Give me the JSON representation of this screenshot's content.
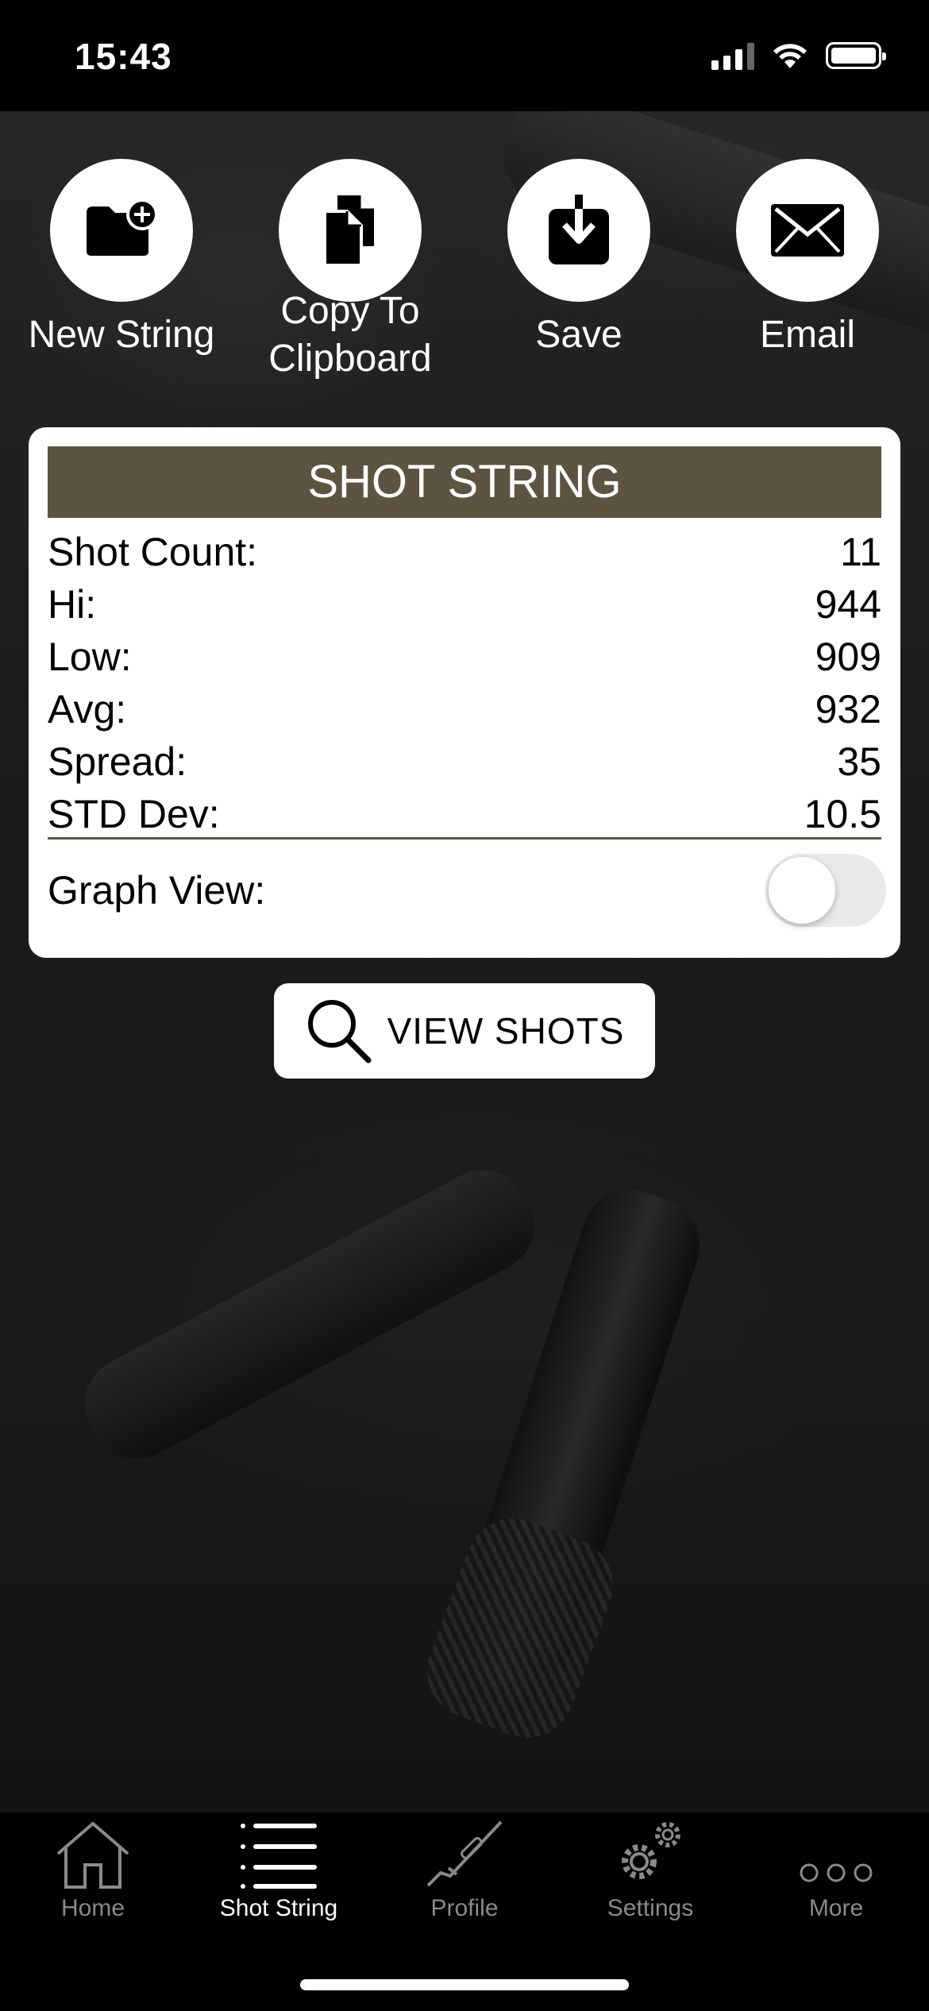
{
  "status_bar": {
    "time": "15:43"
  },
  "actions": [
    {
      "label": "New String",
      "icon": "folder-plus-icon"
    },
    {
      "label": "Copy To Clipboard",
      "icon": "copy-icon"
    },
    {
      "label": "Save",
      "icon": "download-icon"
    },
    {
      "label": "Email",
      "icon": "envelope-icon"
    }
  ],
  "card": {
    "title": "SHOT STRING",
    "stats": [
      {
        "label": "Shot Count:",
        "value": "11"
      },
      {
        "label": "Hi:",
        "value": "944"
      },
      {
        "label": "Low:",
        "value": "909"
      },
      {
        "label": "Avg:",
        "value": "932"
      },
      {
        "label": "Spread:",
        "value": "35"
      },
      {
        "label": "STD Dev:",
        "value": "10.5"
      }
    ],
    "graph_view_label": "Graph View:",
    "graph_view_enabled": false
  },
  "view_shots_label": "VIEW SHOTS",
  "tabs": [
    {
      "label": "Home",
      "icon": "home-icon",
      "active": false
    },
    {
      "label": "Shot String",
      "icon": "list-icon",
      "active": true
    },
    {
      "label": "Profile",
      "icon": "rifle-icon",
      "active": false
    },
    {
      "label": "Settings",
      "icon": "gears-icon",
      "active": false
    },
    {
      "label": "More",
      "icon": "more-icon",
      "active": false
    }
  ],
  "colors": {
    "accent": "#5d5341",
    "background": "#000000",
    "inactive_tab": "#8a8a8a"
  }
}
